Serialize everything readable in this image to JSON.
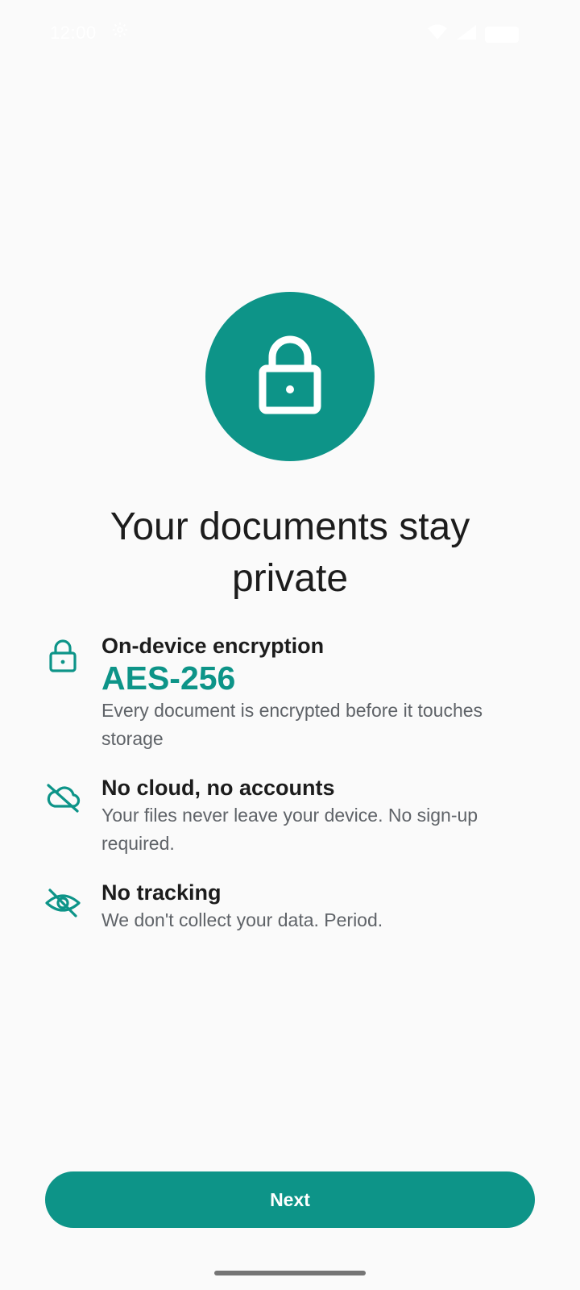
{
  "status_bar": {
    "time": "12:00",
    "icons": [
      "settings-icon",
      "wifi-icon",
      "signal-icon",
      "battery-icon"
    ]
  },
  "hero": {
    "icon": "lock-icon"
  },
  "title": "Your documents stay private",
  "features": [
    {
      "icon": "lock-icon",
      "title": "On-device encryption",
      "highlight": "AES-256",
      "description": "Every document is encrypted before it touches storage"
    },
    {
      "icon": "cloud-off-icon",
      "title": "No cloud, no accounts",
      "description": "Your files never leave your device. No sign-up required."
    },
    {
      "icon": "eye-off-icon",
      "title": "No tracking",
      "description": "We don't collect your data. Period."
    }
  ],
  "next_button": {
    "label": "Next"
  },
  "colors": {
    "accent": "#0D9488",
    "background": "#FAFAFA",
    "text_primary": "#1C1C1C",
    "text_secondary": "#5F6368"
  }
}
